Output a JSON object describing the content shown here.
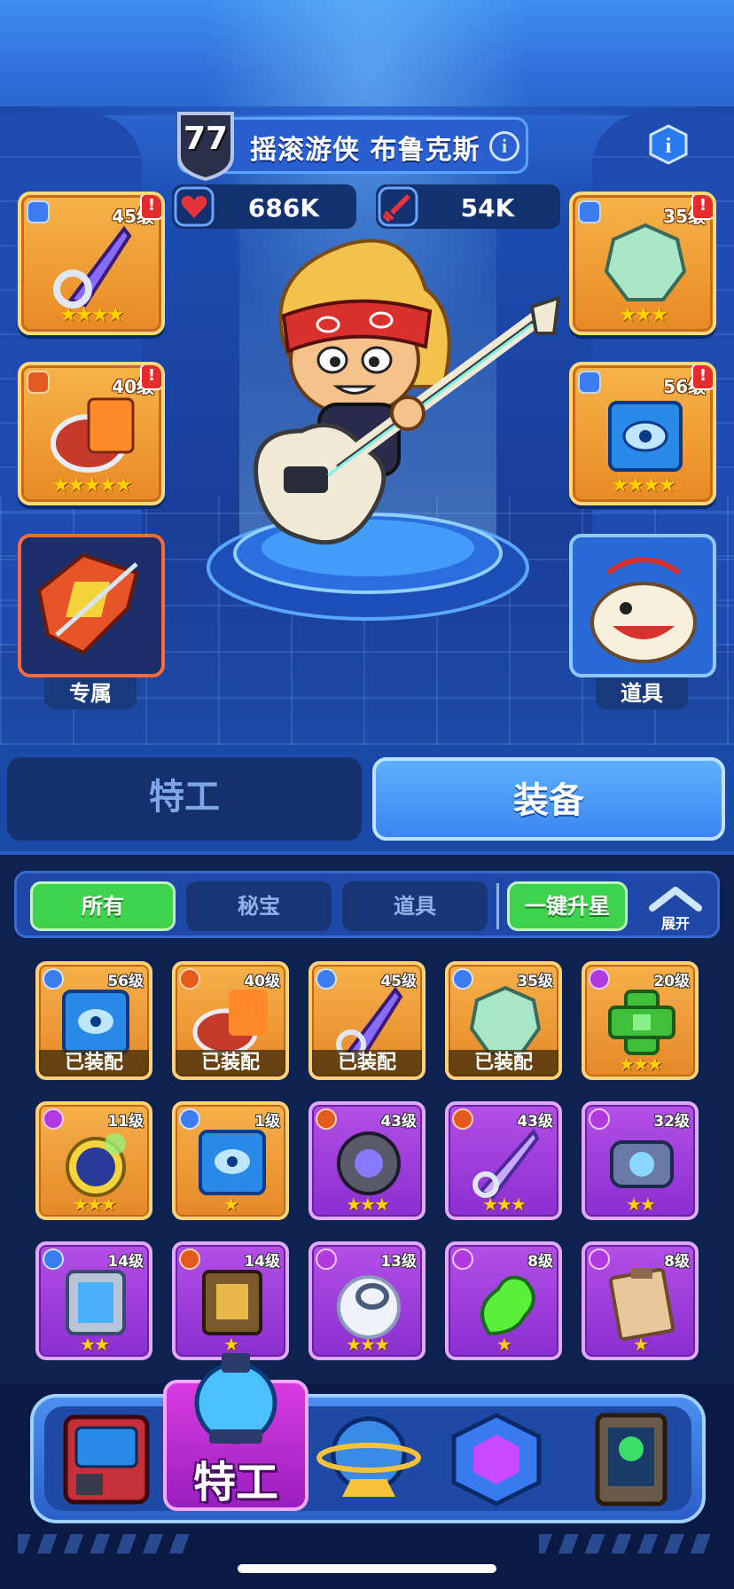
{
  "hero": {
    "level": "77",
    "name": "摇滚游侠 布鲁克斯",
    "hp": "686K",
    "attack": "54K"
  },
  "slots": {
    "left": [
      {
        "level": "45级",
        "stars": "★★★★",
        "alert": "!"
      },
      {
        "level": "40级",
        "stars": "★★★★★",
        "alert": "!"
      }
    ],
    "right": [
      {
        "level": "35级",
        "stars": "★★★",
        "alert": "!"
      },
      {
        "level": "56级",
        "stars": "★★★★",
        "alert": "!"
      }
    ],
    "exclusive_label": "专属",
    "item_label": "道具"
  },
  "tabs": {
    "agent": "特工",
    "equipment": "装备"
  },
  "filters": {
    "all": "所有",
    "secret": "秘宝",
    "item": "道具",
    "upgrade": "一键升星",
    "expand": "展开"
  },
  "inventory": [
    {
      "level": "56级",
      "status": "已装配",
      "stars": ""
    },
    {
      "level": "40级",
      "status": "已装配",
      "stars": ""
    },
    {
      "level": "45级",
      "status": "已装配",
      "stars": ""
    },
    {
      "level": "35级",
      "status": "已装配",
      "stars": ""
    },
    {
      "level": "20级",
      "status": "",
      "stars": "★★★"
    },
    {
      "level": "11级",
      "status": "",
      "stars": "★★★"
    },
    {
      "level": "1级",
      "status": "",
      "stars": "★"
    },
    {
      "level": "43级",
      "status": "",
      "stars": "★★★"
    },
    {
      "level": "43级",
      "status": "",
      "stars": "★★★"
    },
    {
      "level": "32级",
      "status": "",
      "stars": "★★"
    },
    {
      "level": "14级",
      "status": "",
      "stars": "★★"
    },
    {
      "level": "14级",
      "status": "",
      "stars": "★"
    },
    {
      "level": "13级",
      "status": "",
      "stars": "★★★"
    },
    {
      "level": "8级",
      "status": "",
      "stars": "★"
    },
    {
      "level": "8级",
      "status": "",
      "stars": "★"
    }
  ],
  "nav": {
    "agent_label": "特工"
  },
  "colors": {
    "rarity_orange": "#f6b04a",
    "rarity_purple": "#b34fe6",
    "active_green": "#3fd24c",
    "primary_blue": "#3b86f0"
  }
}
